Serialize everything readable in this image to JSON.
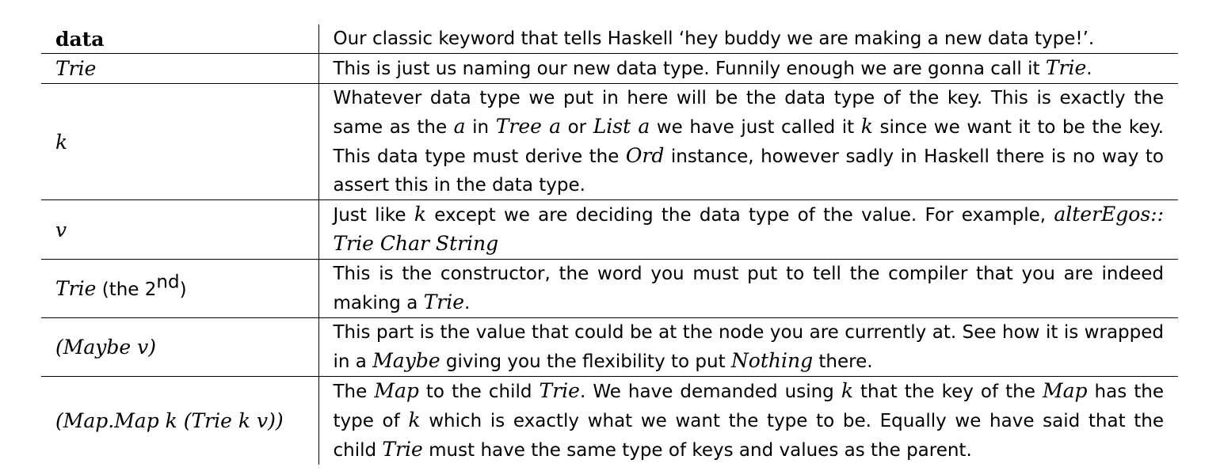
{
  "rows": [
    {
      "term": "data",
      "desc": [
        "Our classic keyword that tells Haskell ‘hey buddy we are making a new data type!’."
      ]
    },
    {
      "term": "Trie",
      "desc": [
        "This is just us naming our new data type. Funnily enough we are gonna call it ",
        "Trie",
        "."
      ]
    },
    {
      "term": "k",
      "desc": [
        "Whatever data type we put in here will be the data type of the key. This is exactly the same as the ",
        "a",
        " in ",
        "Tree a",
        " or ",
        "List a",
        " we have just called it ",
        "k",
        " since we want it to be the key. This data type must derive the ",
        "Ord",
        " instance, however sadly in Haskell there is no way to assert this in the data type."
      ]
    },
    {
      "term": "v",
      "desc": [
        "Just like ",
        "k",
        " except we are deciding the data type of the value. For example, ",
        "alterEgos::",
        " ",
        "Trie Char String"
      ]
    },
    {
      "term": "Trie",
      "term_suffix_pre": " (the 2",
      "term_sup": "nd",
      "term_suffix_post": ")",
      "desc": [
        "This is the constructor, the word you must put to tell the compiler that you are indeed making a ",
        "Trie",
        "."
      ]
    },
    {
      "term": "(Maybe v)",
      "desc": [
        "This part is the value that could be at the node you are currently at. See how it is wrapped in a ",
        "Maybe",
        " giving you the flexibility to put ",
        "Nothing",
        " there."
      ]
    },
    {
      "term": "(Map.Map k (Trie k v))",
      "desc": [
        "The ",
        "Map",
        " to the child ",
        "Trie",
        ". We have demanded using ",
        "k",
        " that the key of the ",
        "Map",
        " has the type of ",
        "k",
        " which is exactly what we want the type to be. Equally we have said that the child ",
        "Trie",
        " must have the same type of keys and values as the parent."
      ]
    }
  ]
}
